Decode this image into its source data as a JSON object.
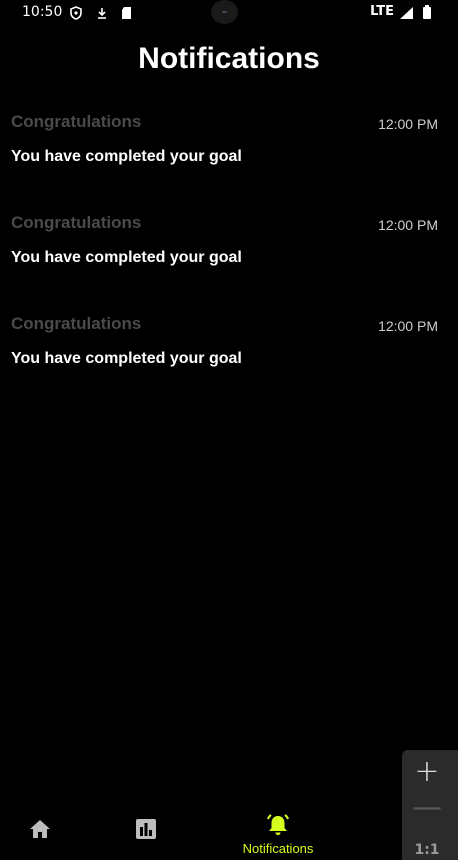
{
  "status_bar": {
    "time": "10:50",
    "network": "LTE"
  },
  "header": {
    "title": "Notifications"
  },
  "notifications": [
    {
      "title": "Congratulations",
      "time": "12:00 PM",
      "body": "You have completed your goal"
    },
    {
      "title": "Congratulations",
      "time": "12:00 PM",
      "body": "You have completed your goal"
    },
    {
      "title": "Congratulations",
      "time": "12:00 PM",
      "body": "You have completed your goal"
    }
  ],
  "bottom_nav": {
    "items": [
      {
        "icon": "home-icon",
        "label": ""
      },
      {
        "icon": "stats-icon",
        "label": ""
      },
      {
        "icon": "bell-icon",
        "label": "Notifications",
        "active": true
      }
    ],
    "active_color": "#d4ff1e",
    "inactive_color": "#bdbdbd"
  },
  "zoom_controls": {
    "zoom_in": "+",
    "zoom_out": "—",
    "reset": "1:1"
  }
}
